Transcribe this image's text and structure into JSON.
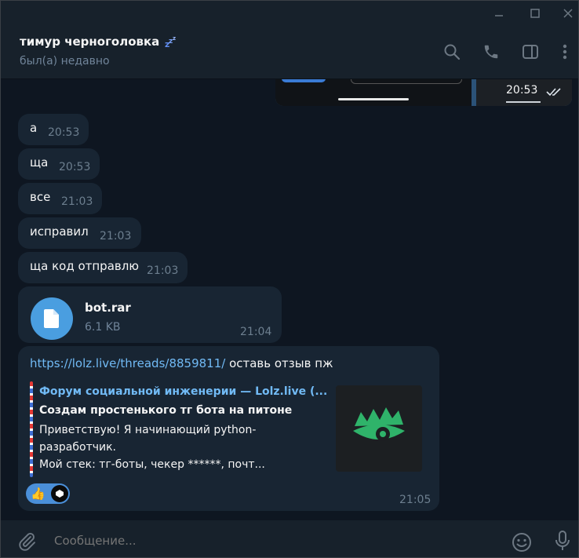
{
  "header": {
    "name": "тимур черноголовка",
    "status": "был(а) недавно"
  },
  "outgoing_media": {
    "time": "20:53"
  },
  "messages": [
    {
      "text": "а",
      "time": "20:53"
    },
    {
      "text": "ща",
      "time": "20:53"
    },
    {
      "text": "все",
      "time": "21:03"
    },
    {
      "text": "исправил",
      "time": "21:03"
    },
    {
      "text": "ща код отправлю",
      "time": "21:03"
    }
  ],
  "file_message": {
    "name": "bot.rar",
    "size": "6.1 KB",
    "time": "21:04"
  },
  "link_message": {
    "url": "https://lolz.live/threads/8859811/",
    "text": " оставь отзыв пж",
    "time": "21:05",
    "preview": {
      "site": "Форум социальной инженерии —  Lolz.live (...",
      "title": "Создам простенького тг бота на питоне",
      "desc_lines": [
        "Приветствую! Я начинающий python-",
        "разработчик.",
        "Мой стек: тг-боты, чекер ******, почт..."
      ]
    },
    "reaction": {
      "emoji": "👍",
      "icon": "thumbs-up"
    }
  },
  "composer": {
    "placeholder": "Сообщение..."
  },
  "colors": {
    "background": "#0e1621",
    "panel": "#17212b",
    "incoming_bubble": "#182533",
    "link": "#71baf5",
    "accent": "#4a9ee0",
    "thumb_green": "#2fb36a"
  }
}
